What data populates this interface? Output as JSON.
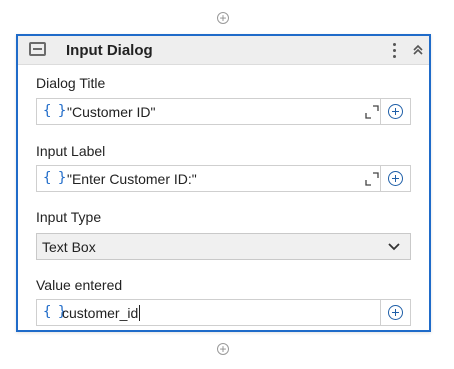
{
  "activity": {
    "title": "Input Dialog",
    "icon": "dialog-box-icon",
    "menu_icon": "more-vertical-icon",
    "collapse_icon": "double-chevron-up-icon"
  },
  "connectors": {
    "icon": "plus-circle-icon"
  },
  "fields": {
    "dialog_title": {
      "label": "Dialog Title",
      "value": "\"Customer ID\""
    },
    "input_label": {
      "label": "Input Label",
      "value": "\"Enter Customer ID:\""
    },
    "input_type": {
      "label": "Input Type",
      "selected": "Text Box"
    },
    "value_entered": {
      "label": "Value entered",
      "value": "customer_id"
    }
  },
  "colors": {
    "accent": "#1f6bc9",
    "header_bg": "#eeeeee"
  }
}
